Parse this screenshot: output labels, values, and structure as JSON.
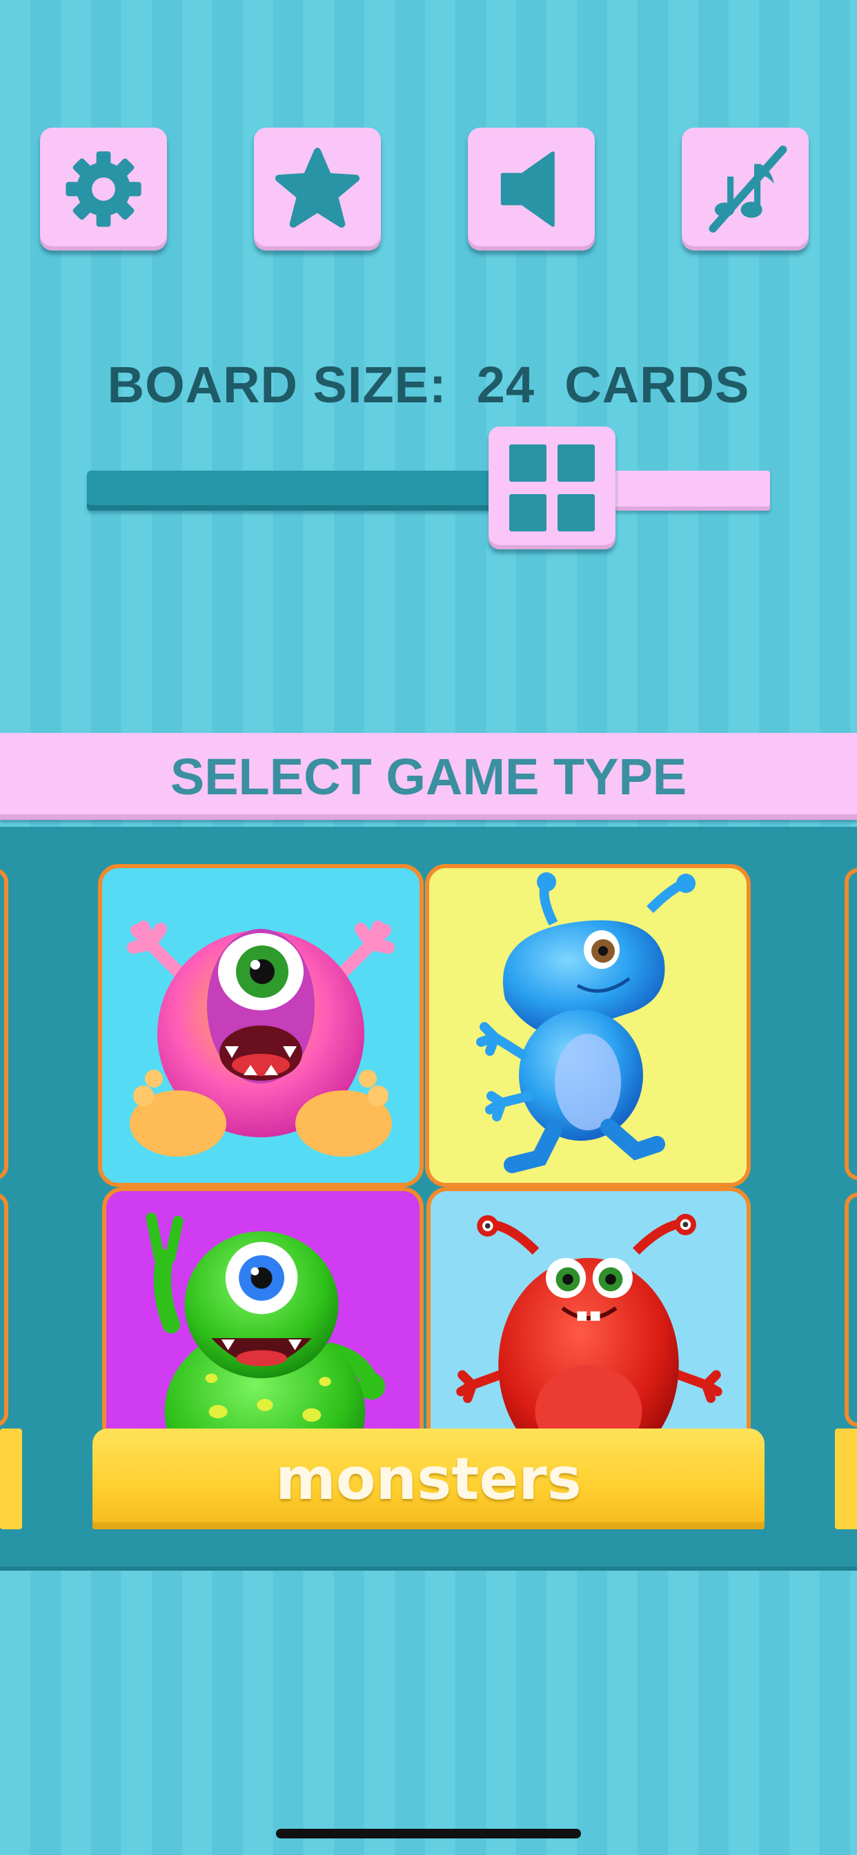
{
  "toolbar": {
    "settings_icon": "gear-icon",
    "rate_icon": "star-icon",
    "sound_icon": "speaker-icon",
    "music_icon": "music-muted-icon"
  },
  "board": {
    "label": "BOARD SIZE:  24  CARDS",
    "slider_thumb_icon": "grid-icon",
    "slider_level": 0.6
  },
  "game_type": {
    "title": "SELECT GAME TYPE",
    "current": "monsters",
    "card_colors": [
      "#56dbf4",
      "#f5f57a",
      "#cf3cf2",
      "#8fdcf7"
    ],
    "frame_color": "#f18b2b"
  },
  "colors": {
    "background": "#64cfe0",
    "button_face": "#f9c6f7",
    "icon": "#2894a6",
    "panel": "#2895a7",
    "tag": "#ffd33d"
  }
}
